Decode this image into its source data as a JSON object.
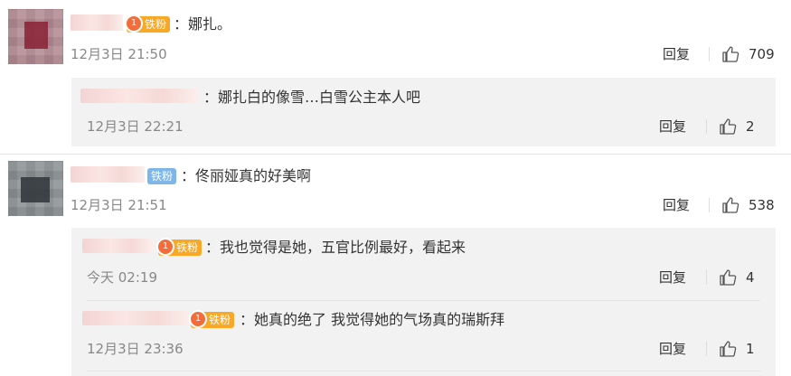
{
  "comments": [
    {
      "text": "：娜扎。",
      "badge": "铁粉",
      "time": "12月3日 21:50",
      "reply_label": "回复",
      "likes": "709"
    },
    {
      "text": "：佟丽娅真的好美啊",
      "badge": "铁粉",
      "time": "12月3日 21:51",
      "reply_label": "回复",
      "likes": "538"
    }
  ],
  "replies": [
    {
      "text": "：娜扎白的像雪…白雪公主本人吧",
      "time": "12月3日 22:21",
      "reply_label": "回复",
      "likes": "2"
    },
    {
      "text": "：我也觉得是她，五官比例最好，看起来",
      "badge": "铁粉",
      "time": "今天 02:19",
      "reply_label": "回复",
      "likes": "4"
    },
    {
      "text": "：她真的绝了  我觉得她的气场真的瑞斯拜",
      "badge": "铁粉",
      "time": "12月3日 23:36",
      "reply_label": "回复",
      "likes": "1"
    }
  ],
  "colors": {
    "badge_orange": "#f9a825",
    "badge_blue": "#7fb6e8",
    "reply_bg": "#f2f2f2"
  },
  "icons": {
    "like": "thumbs-up-icon",
    "fan_badge": "fan-level-icon"
  }
}
